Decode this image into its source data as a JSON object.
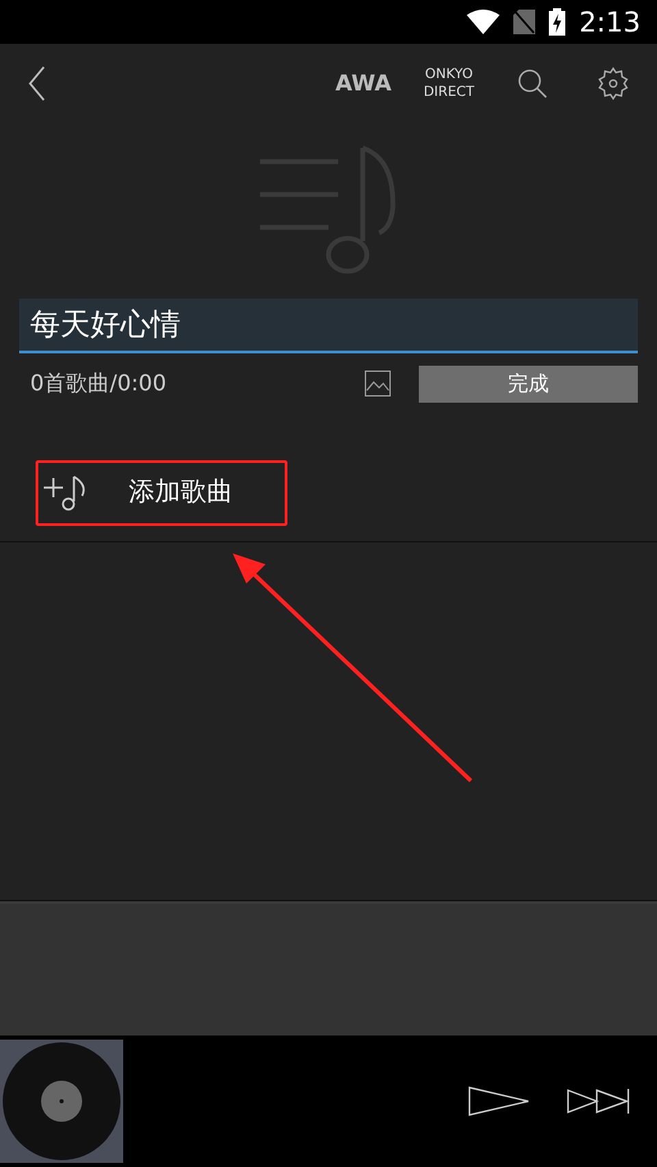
{
  "status_bar": {
    "time": "2:13"
  },
  "header": {
    "services": [
      {
        "label": "AWA",
        "kind": "bold"
      },
      {
        "label": "ONKYO DIRECT",
        "kind": "stacked"
      }
    ]
  },
  "playlist": {
    "title": "每天好心情",
    "summary": "0首歌曲/0:00",
    "done_button": "完成"
  },
  "add_song": {
    "label": "添加歌曲",
    "highlighted": true
  }
}
